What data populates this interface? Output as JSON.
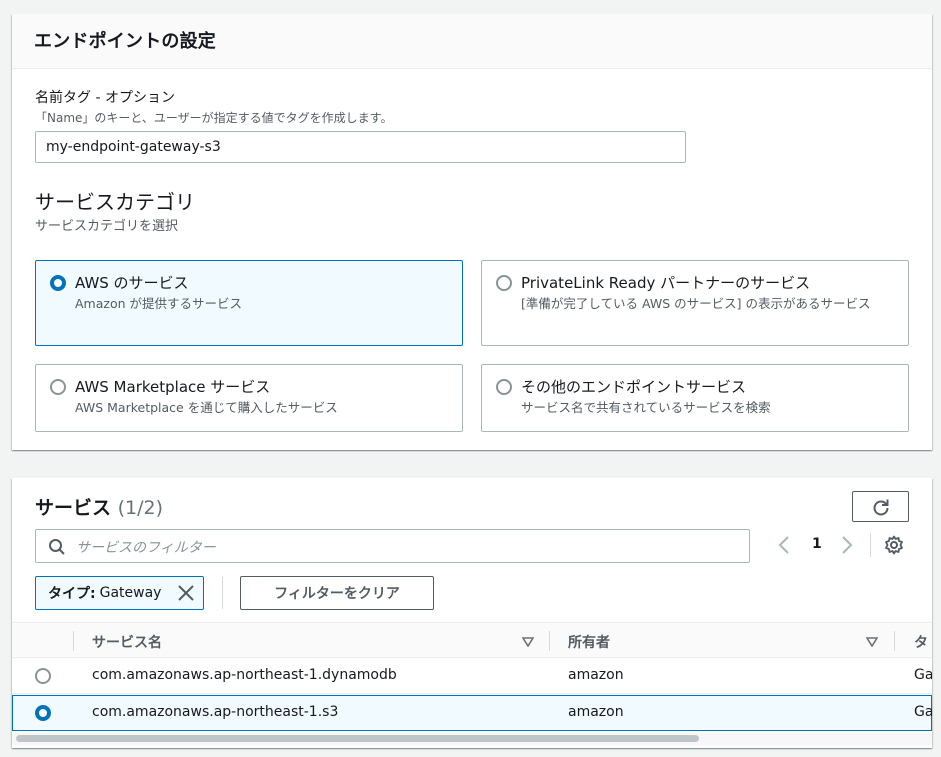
{
  "endpoint_settings": {
    "title": "エンドポイントの設定",
    "name_tag": {
      "label": "名前タグ - オプション",
      "description": "「Name」のキーと、ユーザーが指定する値でタグを作成します。",
      "value": "my-endpoint-gateway-s3"
    },
    "service_category": {
      "title": "サービスカテゴリ",
      "description": "サービスカテゴリを選択",
      "options": [
        {
          "title": "AWS のサービス",
          "description": "Amazon が提供するサービス",
          "selected": true
        },
        {
          "title": "PrivateLink Ready パートナーのサービス",
          "description": "[準備が完了している AWS のサービス] の表示があるサービス",
          "selected": false
        },
        {
          "title": "AWS Marketplace サービス",
          "description": "AWS Marketplace を通じて購入したサービス",
          "selected": false
        },
        {
          "title": "その他のエンドポイントサービス",
          "description": "サービス名で共有されているサービスを検索",
          "selected": false
        }
      ]
    }
  },
  "services": {
    "title": "サービス",
    "count": "(1/2)",
    "search_placeholder": "サービスのフィルター",
    "page": "1",
    "filter_token": {
      "key": "タイプ:",
      "value": "Gateway"
    },
    "clear_filters_label": "フィルターをクリア",
    "columns": [
      "サービス名",
      "所有者",
      "タ"
    ],
    "rows": [
      {
        "service_name": "com.amazonaws.ap-northeast-1.dynamodb",
        "owner": "amazon",
        "type": "Ga",
        "selected": false
      },
      {
        "service_name": "com.amazonaws.ap-northeast-1.s3",
        "owner": "amazon",
        "type": "Ga",
        "selected": true
      }
    ]
  },
  "colors": {
    "accent": "#0073bb",
    "selected_bg": "#f1faff",
    "border": "#aab7b8"
  }
}
